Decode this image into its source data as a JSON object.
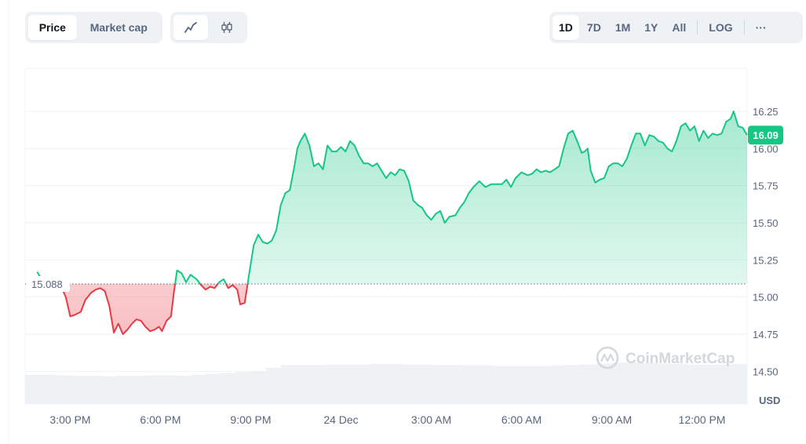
{
  "toolbar": {
    "type_tabs": [
      {
        "label": "Price",
        "active": true
      },
      {
        "label": "Market cap",
        "active": false
      }
    ],
    "style_tabs": [
      {
        "icon": "line-chart-icon",
        "active": true
      },
      {
        "icon": "candlestick-icon",
        "active": false
      }
    ],
    "range_tabs": [
      {
        "label": "1D",
        "active": true
      },
      {
        "label": "7D",
        "active": false
      },
      {
        "label": "1M",
        "active": false
      },
      {
        "label": "1Y",
        "active": false
      },
      {
        "label": "All",
        "active": false
      }
    ],
    "log_label": "LOG",
    "more_label": "···"
  },
  "watermark": "CoinMarketCap",
  "colors": {
    "up": "#16c784",
    "down": "#ea3943",
    "grid": "#eff2f5",
    "axis_text": "#58667e",
    "volume": "#eff2f5",
    "baseline": "#58667e"
  },
  "chart_data": {
    "type": "area",
    "x_label_positions": [
      "3:00 PM",
      "6:00 PM",
      "9:00 PM",
      "24 Dec",
      "3:00 AM",
      "6:00 AM",
      "9:00 AM",
      "12:00 PM"
    ],
    "x_ticks": [
      1.5,
      4.5,
      7.5,
      10.5,
      13.5,
      16.5,
      19.5,
      22.5
    ],
    "x_range": [
      0,
      24
    ],
    "ylim": [
      14.28,
      16.54
    ],
    "y_ticks": [
      "16.25",
      "16.00",
      "15.75",
      "15.50",
      "15.25",
      "15.00",
      "14.75",
      "14.50"
    ],
    "y_tick_values": [
      16.25,
      16.0,
      15.75,
      15.5,
      15.25,
      15.0,
      14.75,
      14.5
    ],
    "y_unit": "USD",
    "baseline": {
      "value": 15.088,
      "label": "15.088"
    },
    "current": {
      "value": 16.09,
      "label": "16.09"
    },
    "series": [
      {
        "x": [
          0.4,
          0.55,
          0.7,
          0.85,
          1.0,
          1.2,
          1.35,
          1.5,
          1.65,
          1.85,
          2.0,
          2.2,
          2.35,
          2.5,
          2.65,
          2.8,
          2.95,
          3.1,
          3.25,
          3.4,
          3.55,
          3.7,
          3.85,
          4.0,
          4.15,
          4.3,
          4.45,
          4.55,
          4.7,
          4.85,
          4.95,
          5.05,
          5.2,
          5.35,
          5.5,
          5.7,
          5.85,
          6.0,
          6.15,
          6.3,
          6.45,
          6.6,
          6.75,
          6.9,
          7.05,
          7.15,
          7.3,
          7.45,
          7.6,
          7.75,
          7.9,
          8.05,
          8.2,
          8.35,
          8.5,
          8.65,
          8.8,
          8.95,
          9.05,
          9.15,
          9.3,
          9.45,
          9.6,
          9.75,
          9.9,
          10.05,
          10.2,
          10.35,
          10.5,
          10.65,
          10.8,
          10.95,
          11.1,
          11.25,
          11.4,
          11.55,
          11.7,
          11.85,
          12.0,
          12.15,
          12.3,
          12.45,
          12.6,
          12.75,
          12.9,
          13.05,
          13.2,
          13.35,
          13.5,
          13.65,
          13.8,
          13.95,
          14.1,
          14.3,
          14.45,
          14.6,
          14.75,
          14.9,
          15.1,
          15.3,
          15.5,
          15.7,
          15.85,
          16.0,
          16.15,
          16.3,
          16.5,
          16.7,
          16.85,
          17.0,
          17.15,
          17.3,
          17.45,
          17.6,
          17.75,
          17.9,
          18.05,
          18.2,
          18.35,
          18.5,
          18.6,
          18.7,
          18.8,
          18.95,
          19.1,
          19.25,
          19.4,
          19.55,
          19.7,
          19.85,
          20.0,
          20.15,
          20.3,
          20.45,
          20.6,
          20.75,
          20.9,
          21.05,
          21.2,
          21.35,
          21.5,
          21.65,
          21.8,
          21.95,
          22.1,
          22.25,
          22.4,
          22.55,
          22.7,
          22.85,
          23.0,
          23.15,
          23.3,
          23.45,
          23.55,
          23.7,
          23.85,
          24.0
        ],
        "y": [
          15.17,
          15.12,
          15.1,
          15.09,
          15.08,
          15.07,
          15.0,
          14.87,
          14.88,
          14.9,
          14.98,
          15.03,
          15.05,
          15.06,
          15.04,
          14.94,
          14.76,
          14.82,
          14.75,
          14.78,
          14.82,
          14.85,
          14.84,
          14.8,
          14.77,
          14.78,
          14.8,
          14.77,
          14.84,
          14.87,
          15.04,
          15.18,
          15.16,
          15.1,
          15.15,
          15.12,
          15.08,
          15.05,
          15.07,
          15.06,
          15.1,
          15.12,
          15.06,
          15.08,
          15.05,
          14.95,
          14.96,
          15.16,
          15.35,
          15.42,
          15.37,
          15.36,
          15.38,
          15.45,
          15.62,
          15.7,
          15.72,
          15.88,
          16.0,
          16.05,
          16.1,
          16.02,
          15.88,
          15.9,
          15.86,
          16.02,
          15.98,
          15.98,
          16.01,
          15.98,
          16.05,
          16.02,
          15.95,
          15.9,
          15.9,
          15.88,
          15.9,
          15.85,
          15.8,
          15.84,
          15.82,
          15.86,
          15.85,
          15.78,
          15.65,
          15.62,
          15.6,
          15.55,
          15.52,
          15.56,
          15.58,
          15.5,
          15.54,
          15.55,
          15.6,
          15.64,
          15.7,
          15.74,
          15.78,
          15.74,
          15.76,
          15.76,
          15.76,
          15.79,
          15.74,
          15.8,
          15.84,
          15.82,
          15.83,
          15.86,
          15.84,
          15.85,
          15.84,
          15.86,
          15.88,
          16.0,
          16.1,
          16.12,
          16.05,
          15.97,
          15.98,
          16.0,
          15.85,
          15.77,
          15.79,
          15.8,
          15.88,
          15.9,
          15.9,
          15.88,
          15.93,
          16.02,
          16.1,
          16.1,
          16.02,
          16.09,
          16.08,
          16.05,
          16.04,
          16.0,
          15.98,
          16.05,
          16.15,
          16.17,
          16.12,
          16.15,
          16.05,
          16.12,
          16.07,
          16.1,
          16.09,
          16.1,
          16.18,
          16.2,
          16.25,
          16.15,
          16.14,
          16.09
        ]
      }
    ],
    "volume_levels": [
      0.62,
      0.62,
      0.61,
      0.6,
      0.6,
      0.59,
      0.6,
      0.6,
      0.61,
      0.61,
      0.6,
      0.62,
      0.64,
      0.66,
      0.68,
      0.7,
      0.77,
      0.83,
      0.83,
      0.83,
      0.84,
      0.84,
      0.84,
      0.85,
      0.85,
      0.84,
      0.84,
      0.83,
      0.83,
      0.82,
      0.82,
      0.81,
      0.81,
      0.81,
      0.81,
      0.82,
      0.83,
      0.84,
      0.86,
      0.88,
      0.88,
      0.87,
      0.86,
      0.85,
      0.84,
      0.84,
      0.84,
      0.85
    ]
  }
}
